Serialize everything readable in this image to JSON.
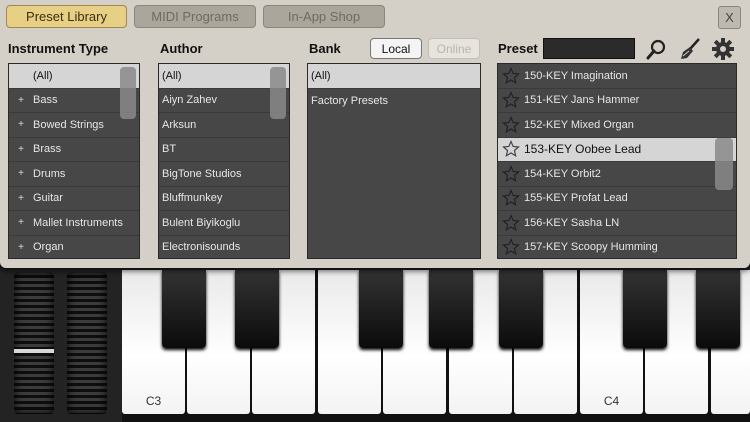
{
  "tabs": [
    {
      "label": "Preset Library",
      "active": true
    },
    {
      "label": "MIDI Programs",
      "active": false
    },
    {
      "label": "In-App Shop",
      "active": false
    }
  ],
  "close_label": "X",
  "columns": {
    "instrument_type": "Instrument Type",
    "author": "Author",
    "bank": "Bank",
    "preset": "Preset"
  },
  "bank_buttons": {
    "local": "Local",
    "online": "Online"
  },
  "instrument_types": [
    "(All)",
    "Bass",
    "Bowed Strings",
    "Brass",
    "Drums",
    "Guitar",
    "Mallet Instruments",
    "Organ"
  ],
  "authors": [
    "(All)",
    "Aiyn Zahev",
    "Arksun",
    "BT",
    "BigTone Studios",
    "Bluffmunkey",
    "Bulent Biyikoglu",
    "Electronisounds"
  ],
  "banks": [
    "(All)",
    "Factory Presets"
  ],
  "presets": [
    "150-KEY Imagination",
    "151-KEY Jans Hammer",
    "152-KEY Mixed Organ",
    "153-KEY Oobee Lead",
    "154-KEY Orbit2",
    "155-KEY Profat Lead",
    "156-KEY Sasha LN",
    "157-KEY Scoopy Humming"
  ],
  "selected_preset": "153-KEY Oobee Lead",
  "icons": [
    "search-icon",
    "broom-icon",
    "gear-icon",
    "star-icon"
  ],
  "key_labels": {
    "c3": "C3",
    "c4": "C4"
  },
  "colors": {
    "panel": "#d4d0c7",
    "active_tab": "#e8cf86",
    "list_bg": "#474747",
    "selected_row": "#d5d5d5"
  }
}
